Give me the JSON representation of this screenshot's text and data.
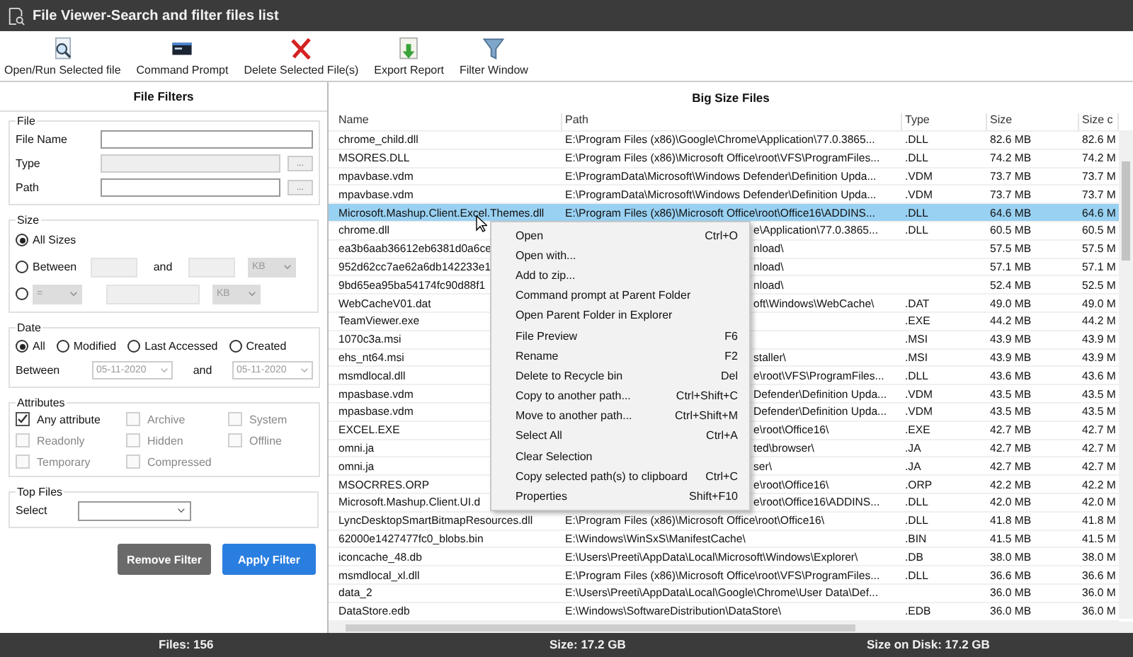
{
  "window": {
    "title": "File Viewer-Search and filter files list"
  },
  "toolbar": [
    {
      "label": "Open/Run Selected file",
      "kind": "open"
    },
    {
      "label": "Command Prompt",
      "kind": "prompt"
    },
    {
      "label": "Delete Selected File(s)",
      "kind": "delete"
    },
    {
      "label": "Export Report",
      "kind": "export"
    },
    {
      "label": "Filter Window",
      "kind": "filter"
    }
  ],
  "filters": {
    "title": "File Filters",
    "file": {
      "legend": "File",
      "fields": [
        {
          "label": "File Name",
          "disabled": false
        },
        {
          "label": "Type",
          "disabled": true,
          "browse": "..."
        },
        {
          "label": "Path",
          "disabled": false,
          "browse": "..."
        }
      ]
    },
    "size": {
      "legend": "Size",
      "options": [
        {
          "kind": "plain",
          "label": "All Sizes",
          "selected": true
        },
        {
          "kind": "between",
          "label": "Between",
          "and": "and",
          "unit": "KB",
          "selected": false
        },
        {
          "kind": "compare",
          "operator": "=",
          "unit": "KB",
          "selected": false
        }
      ]
    },
    "date": {
      "legend": "Date",
      "options": [
        {
          "label": "All",
          "selected": true
        },
        {
          "label": "Modified",
          "selected": false
        },
        {
          "label": "Last Accessed",
          "selected": false
        },
        {
          "label": "Created",
          "selected": false
        }
      ],
      "between": "Between",
      "from": "05-11-2020",
      "and": "and",
      "to": "05-11-2020"
    },
    "attributes": {
      "legend": "Attributes",
      "items": [
        {
          "label": "Any attribute",
          "checked": true,
          "disabled": false
        },
        {
          "label": "Archive",
          "checked": false,
          "disabled": true
        },
        {
          "label": "System",
          "checked": false,
          "disabled": true
        },
        {
          "label": "Readonly",
          "checked": false,
          "disabled": true
        },
        {
          "label": "Hidden",
          "checked": false,
          "disabled": true
        },
        {
          "label": "Offline",
          "checked": false,
          "disabled": true
        },
        {
          "label": "Temporary",
          "checked": false,
          "disabled": true
        },
        {
          "label": "Compressed",
          "checked": false,
          "disabled": true
        }
      ]
    },
    "top_files": {
      "legend": "Top Files",
      "label": "Select"
    },
    "buttons": [
      {
        "label": "Remove Filter",
        "kind": "secondary"
      },
      {
        "label": "Apply Filter",
        "kind": "primary"
      }
    ]
  },
  "table": {
    "title": "Big Size Files",
    "columns": [
      "Name",
      "Path",
      "Type",
      "Size",
      "Size c"
    ],
    "rows": [
      {
        "name": "chrome_child.dll",
        "path": "E:\\Program Files (x86)\\Google\\Chrome\\Application\\77.0.3865...",
        "type": ".DLL",
        "size": "82.6 MB",
        "size_on_disk": "82.6 M",
        "selected": false
      },
      {
        "name": "MSORES.DLL",
        "path": "E:\\Program Files (x86)\\Microsoft Office\\root\\VFS\\ProgramFiles...",
        "type": ".DLL",
        "size": "74.2 MB",
        "size_on_disk": "74.2 M",
        "selected": false
      },
      {
        "name": "mpavbase.vdm",
        "path": "E:\\ProgramData\\Microsoft\\Windows Defender\\Definition Upda...",
        "type": ".VDM",
        "size": "73.7 MB",
        "size_on_disk": "73.7 M",
        "selected": false
      },
      {
        "name": "mpavbase.vdm",
        "path": "E:\\ProgramData\\Microsoft\\Windows Defender\\Definition Upda...",
        "type": ".VDM",
        "size": "73.7 MB",
        "size_on_disk": "73.7 M",
        "selected": false
      },
      {
        "name": "Microsoft.Mashup.Client.Excel.Themes.dll",
        "path": "E:\\Program Files (x86)\\Microsoft Office\\root\\Office16\\ADDINS...",
        "type": ".DLL",
        "size": "64.6 MB",
        "size_on_disk": "64.6 M",
        "selected": true
      },
      {
        "name": "chrome.dll",
        "path": "e\\Application\\77.0.3865...",
        "type": ".DLL",
        "size": "60.5 MB",
        "size_on_disk": "60.5 M",
        "selected": false
      },
      {
        "name": "ea3b6aab36612eb6381d0a6ce",
        "path": "nload\\",
        "size": "57.5 MB",
        "size_on_disk": "57.5 M",
        "selected": false
      },
      {
        "name": "952d62cc7ae62a6db142233e1",
        "path": "nload\\",
        "size": "57.1 MB",
        "size_on_disk": "57.1 M",
        "selected": false
      },
      {
        "name": "9bd65ea95ba54174fc90d88f1",
        "path": "nload\\",
        "size": "52.4 MB",
        "size_on_disk": "52.5 M",
        "selected": false
      },
      {
        "name": "WebCacheV01.dat",
        "path": "oft\\Windows\\WebCache\\",
        "type": ".DAT",
        "size": "49.0 MB",
        "size_on_disk": "49.0 M",
        "selected": false
      },
      {
        "name": "TeamViewer.exe",
        "type": ".EXE",
        "size": "44.2 MB",
        "size_on_disk": "44.2 M",
        "selected": false
      },
      {
        "name": "1070c3a.msi",
        "type": ".MSI",
        "size": "43.9 MB",
        "size_on_disk": "43.9 M",
        "selected": false
      },
      {
        "name": "ehs_nt64.msi",
        "path": "staller\\",
        "type": ".MSI",
        "size": "43.9 MB",
        "size_on_disk": "43.9 M",
        "selected": false
      },
      {
        "name": "msmdlocal.dll",
        "path": "e\\root\\VFS\\ProgramFiles...",
        "type": ".DLL",
        "size": "43.6 MB",
        "size_on_disk": "43.6 M",
        "selected": false
      },
      {
        "name": "mpasbase.vdm",
        "path": "Defender\\Definition Upda...",
        "type": ".VDM",
        "size": "43.5 MB",
        "size_on_disk": "43.5 M",
        "selected": false
      },
      {
        "name": "mpasbase.vdm",
        "path": "Defender\\Definition Upda...",
        "type": ".VDM",
        "size": "43.5 MB",
        "size_on_disk": "43.5 M",
        "selected": false
      },
      {
        "name": "EXCEL.EXE",
        "path": "e\\root\\Office16\\",
        "type": ".EXE",
        "size": "42.7 MB",
        "size_on_disk": "42.7 M",
        "selected": false
      },
      {
        "name": "omni.ja",
        "path": "ted\\browser\\",
        "type": ".JA",
        "size": "42.7 MB",
        "size_on_disk": "42.7 M",
        "selected": false
      },
      {
        "name": "omni.ja",
        "path": "ser\\",
        "type": ".JA",
        "size": "42.7 MB",
        "size_on_disk": "42.7 M",
        "selected": false
      },
      {
        "name": "MSOCRRES.ORP",
        "path": "e\\root\\Office16\\",
        "type": ".ORP",
        "size": "42.2 MB",
        "size_on_disk": "42.2 M",
        "selected": false
      },
      {
        "name": "Microsoft.Mashup.Client.UI.d",
        "path": "e\\root\\Office16\\ADDINS...",
        "type": ".DLL",
        "size": "42.0 MB",
        "size_on_disk": "42.0 M",
        "selected": false
      },
      {
        "name": "LyncDesktopSmartBitmapResources.dll",
        "path": "E:\\Program Files (x86)\\Microsoft Office\\root\\Office16\\",
        "type": ".DLL",
        "size": "41.8 MB",
        "size_on_disk": "41.8 M",
        "selected": false
      },
      {
        "name": "62000e1427477fc0_blobs.bin",
        "path": "E:\\Windows\\WinSxS\\ManifestCache\\",
        "type": ".BIN",
        "size": "41.5 MB",
        "size_on_disk": "41.5 M",
        "selected": false
      },
      {
        "name": "iconcache_48.db",
        "path": "E:\\Users\\Preeti\\AppData\\Local\\Microsoft\\Windows\\Explorer\\",
        "type": ".DB",
        "size": "38.0 MB",
        "size_on_disk": "38.0 M",
        "selected": false
      },
      {
        "name": "msmdlocal_xl.dll",
        "path": "E:\\Program Files (x86)\\Microsoft Office\\root\\VFS\\ProgramFiles...",
        "type": ".DLL",
        "size": "36.6 MB",
        "size_on_disk": "36.6 M",
        "selected": false
      },
      {
        "name": "data_2",
        "path": "E:\\Users\\Preeti\\AppData\\Local\\Google\\Chrome\\User Data\\Def...",
        "size": "36.0 MB",
        "size_on_disk": "36.0 M",
        "selected": false
      },
      {
        "name": "DataStore.edb",
        "path": "E:\\Windows\\SoftwareDistribution\\DataStore\\",
        "type": ".EDB",
        "size": "36.0 MB",
        "size_on_disk": "36.0 M",
        "selected": false
      }
    ]
  },
  "context_menu": {
    "items": [
      {
        "label": "Open",
        "shortcut": "Ctrl+O"
      },
      {
        "label": "Open with..."
      },
      {
        "label": "Add to zip..."
      },
      {
        "label": "Command prompt at Parent Folder"
      },
      {
        "label": "Open Parent Folder in Explorer"
      },
      {
        "label": "File Preview",
        "shortcut": "F6"
      },
      {
        "label": "Rename",
        "shortcut": "F2"
      },
      {
        "label": "Delete to Recycle bin",
        "shortcut": "Del"
      },
      {
        "label": "Copy to another path...",
        "shortcut": "Ctrl+Shift+C"
      },
      {
        "label": "Move to another path...",
        "shortcut": "Ctrl+Shift+M"
      },
      {
        "label": "Select All",
        "shortcut": "Ctrl+A"
      },
      {
        "label": "Clear Selection"
      },
      {
        "label": "Copy selected path(s) to clipboard",
        "shortcut": "Ctrl+C"
      },
      {
        "label": "Properties",
        "shortcut": "Shift+F10"
      }
    ]
  },
  "status_bar": [
    {
      "text": "Files: 156"
    },
    {
      "text": "Size: 17.2 GB"
    },
    {
      "text": "Size on Disk: 17.2 GB"
    }
  ]
}
